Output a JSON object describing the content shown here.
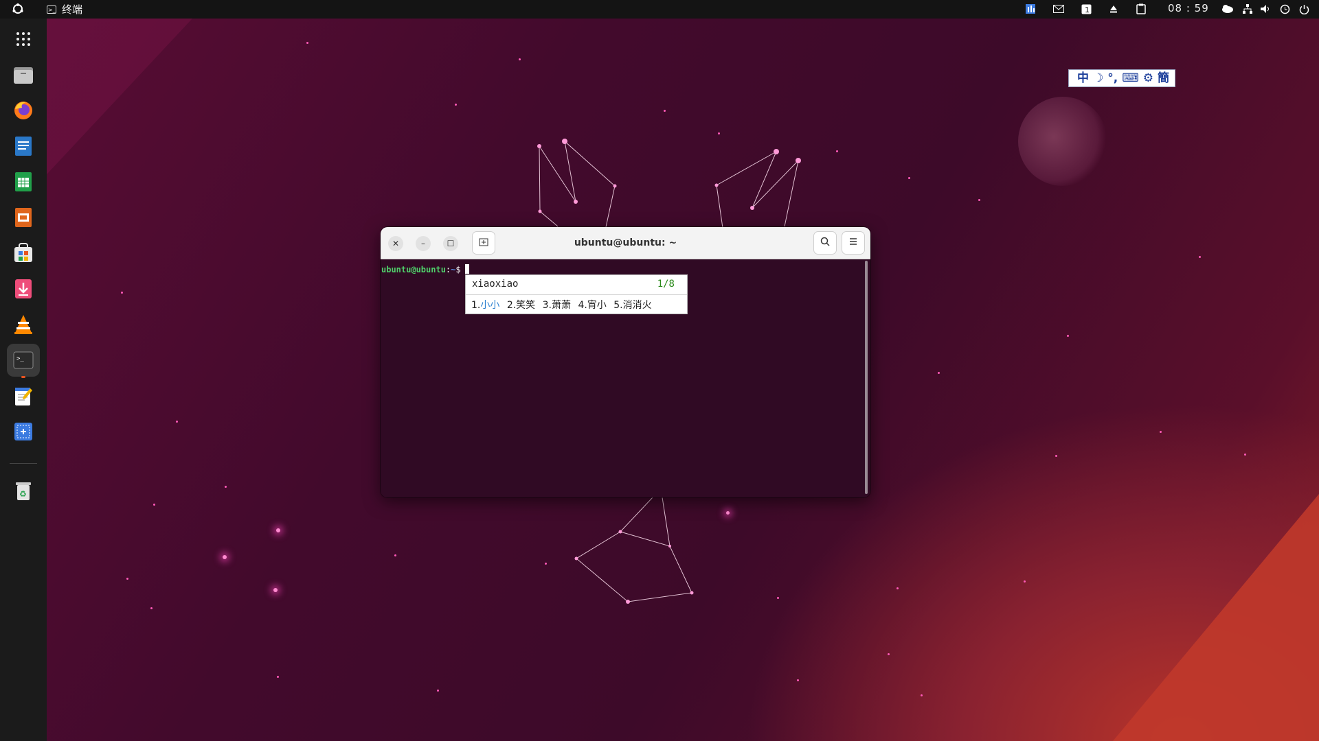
{
  "topbar": {
    "app_name": "终端",
    "clock": "08 : 59",
    "tray_icons": [
      "chart-icon",
      "mail-icon",
      "number-1-icon",
      "eject-icon",
      "clipboard-icon",
      "weather-icon",
      "network-icon",
      "volume-icon",
      "clock-icon",
      "power-icon"
    ]
  },
  "dock": {
    "items": [
      {
        "name": "show-apps-icon",
        "label": "显示应用"
      },
      {
        "name": "files-icon",
        "label": "文件"
      },
      {
        "name": "firefox-icon",
        "label": "Firefox"
      },
      {
        "name": "writer-icon",
        "label": "Writer"
      },
      {
        "name": "calc-icon",
        "label": "Calc"
      },
      {
        "name": "impress-icon",
        "label": "Impress"
      },
      {
        "name": "app-center-icon",
        "label": "App Center"
      },
      {
        "name": "installer-icon",
        "label": "Installer"
      },
      {
        "name": "vlc-icon",
        "label": "VLC"
      },
      {
        "name": "terminal-icon",
        "label": "终端"
      },
      {
        "name": "text-editor-icon",
        "label": "Text Editor"
      },
      {
        "name": "screenshot-icon",
        "label": "Screenshot"
      },
      {
        "name": "trash-icon",
        "label": "Trash"
      }
    ]
  },
  "ime_bar": {
    "mode": "中",
    "width_mode": "☽",
    "punct": "°,",
    "keyboard": "⌨",
    "settings": "⚙",
    "script": "簡"
  },
  "terminal": {
    "title": "ubuntu@ubuntu: ~",
    "prompt_user": "ubuntu@ubuntu",
    "prompt_sep": ":",
    "prompt_path": "~",
    "prompt_symbol": "$"
  },
  "candidates": {
    "input": "xiaoxiao",
    "page": "1/8",
    "items": [
      {
        "index": "1.",
        "word": "小小"
      },
      {
        "index": "2.",
        "word": "笑笑"
      },
      {
        "index": "3.",
        "word": "萧萧"
      },
      {
        "index": "4.",
        "word": "宵小"
      },
      {
        "index": "5.",
        "word": "消消火"
      }
    ]
  },
  "colors": {
    "accent": "#e95420",
    "terminal_bg": "#300a24",
    "prompt_user": "#4fd06a",
    "prompt_path": "#5b8fe4",
    "candidate_selected": "#2a7fd0",
    "page_indicator": "#2a8a1a"
  }
}
